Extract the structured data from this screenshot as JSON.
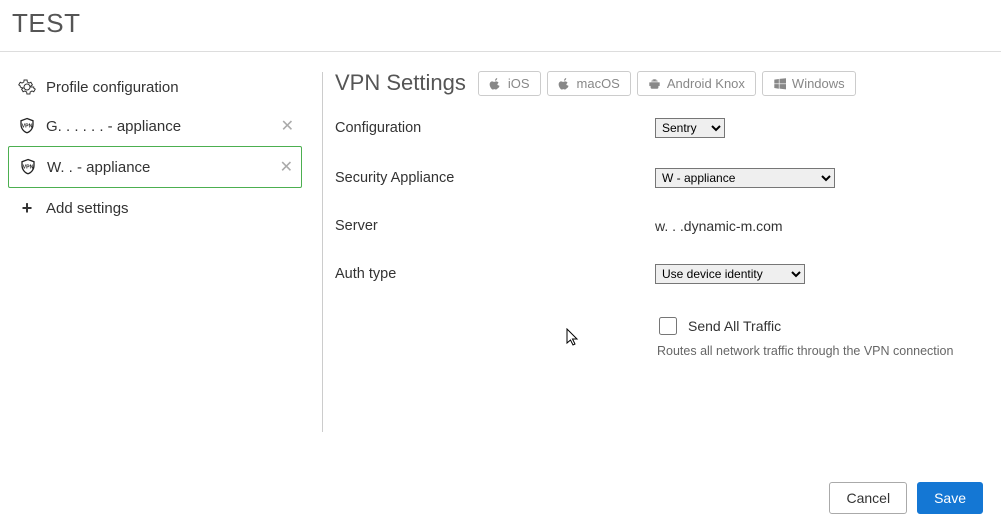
{
  "page": {
    "title": "TEST"
  },
  "sidebar": {
    "items": [
      {
        "label": "Profile configuration",
        "icon": "gear",
        "closable": false,
        "active": false
      },
      {
        "label": "G. . . . . . - appliance",
        "icon": "vpn-shield",
        "closable": true,
        "active": false
      },
      {
        "label": "W. .      - appliance",
        "icon": "vpn-shield",
        "closable": true,
        "active": true
      }
    ],
    "add_label": "Add settings"
  },
  "main": {
    "title": "VPN Settings",
    "platforms": [
      {
        "name": "ios",
        "label": "iOS",
        "icon": "apple"
      },
      {
        "name": "macos",
        "label": "macOS",
        "icon": "apple"
      },
      {
        "name": "android",
        "label": "Android Knox",
        "icon": "android"
      },
      {
        "name": "windows",
        "label": "Windows",
        "icon": "windows"
      }
    ],
    "rows": {
      "configuration": {
        "label": "Configuration",
        "value": "Sentry"
      },
      "security_appliance": {
        "label": "Security Appliance",
        "value": "W          - appliance"
      },
      "server": {
        "label": "Server",
        "value": "w. .                                   .dynamic-m.com"
      },
      "auth_type": {
        "label": "Auth type",
        "value": "Use device identity"
      }
    },
    "send_all": {
      "label": "Send All Traffic",
      "helper": "Routes all network traffic through the VPN connection",
      "checked": false
    }
  },
  "footer": {
    "cancel": "Cancel",
    "save": "Save"
  },
  "icons": {
    "gear": "gear-icon",
    "vpn-shield": "vpn-shield-icon",
    "plus": "plus-icon"
  }
}
